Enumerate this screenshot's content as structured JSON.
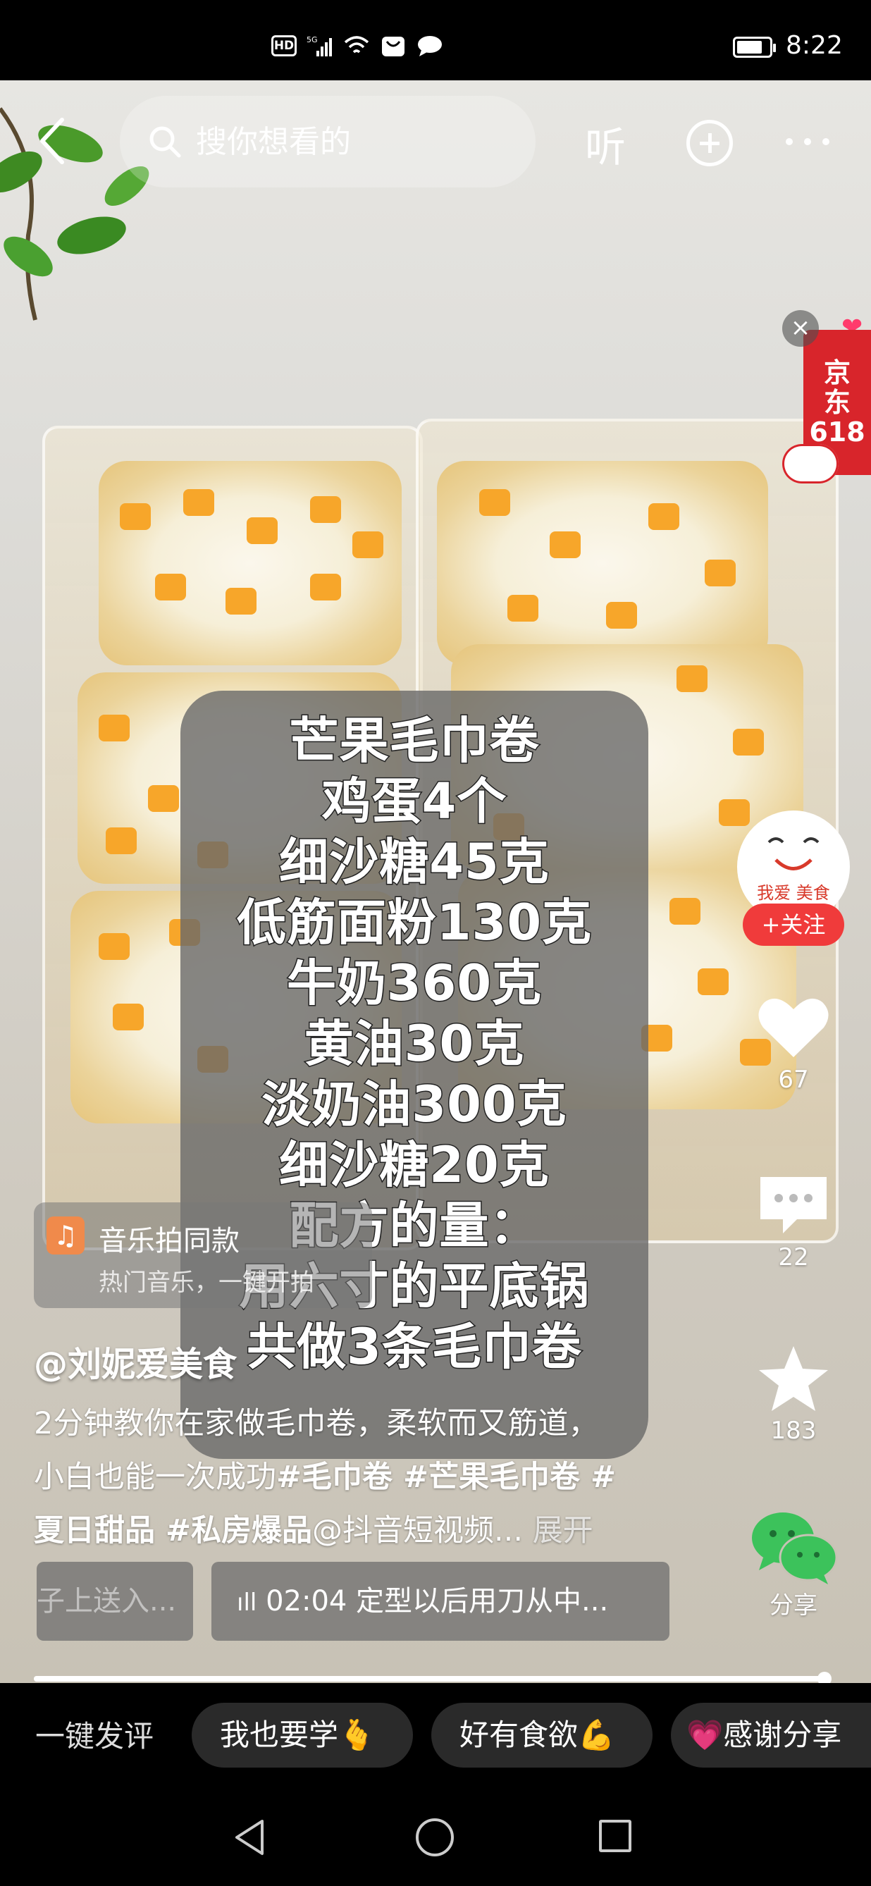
{
  "status_bar": {
    "icons": [
      "hd-icon",
      "signal-5g-icon",
      "wifi-icon",
      "notification-icon",
      "message-icon"
    ],
    "hd_label": "HD",
    "net_label": "5G",
    "battery_level": 0.8,
    "time": "8:22"
  },
  "top_bar": {
    "search_placeholder": "搜你想看的",
    "listen_label": "听"
  },
  "ad": {
    "brand_lines": [
      "京",
      "东",
      "618"
    ]
  },
  "recipe_lines": [
    "芒果毛巾卷",
    "鸡蛋4个",
    "细沙糖45克",
    "低筋面粉130克",
    "牛奶360克",
    "黄油30克",
    "淡奶油300克",
    "细沙糖20克",
    "配方的量：",
    "用六寸的平底锅",
    "共做3条毛巾卷"
  ],
  "creator": {
    "avatar_text": "我爱 美食",
    "follow_label": "+关注"
  },
  "actions": {
    "likes": "67",
    "comments": "22",
    "favorites": "183",
    "share_label": "分享"
  },
  "music": {
    "title": "音乐拍同款",
    "subtitle": "热门音乐，一键开拍"
  },
  "post": {
    "author": "@刘妮爱美食",
    "caption_text_1": "2分钟教你在家做毛巾卷，柔软而又筋道，",
    "caption_text_2": "小白也能一次成功",
    "caption_tags_1": "#毛巾卷 #芒果毛巾卷 #",
    "caption_tags_2": "夏日甜品 #私房爆品",
    "caption_mention": "@抖音短视频...",
    "expand_label": "展开"
  },
  "chapters": {
    "prev_chip": "子上送入...",
    "current_chip": "02:04 定型以后用刀从中..."
  },
  "progress": {
    "played_fraction": 0.99
  },
  "comment_bar": {
    "label": "一键发评",
    "quick_replies": [
      "我也要学🫰",
      "好有食欲💪",
      "💗感谢分享"
    ]
  }
}
